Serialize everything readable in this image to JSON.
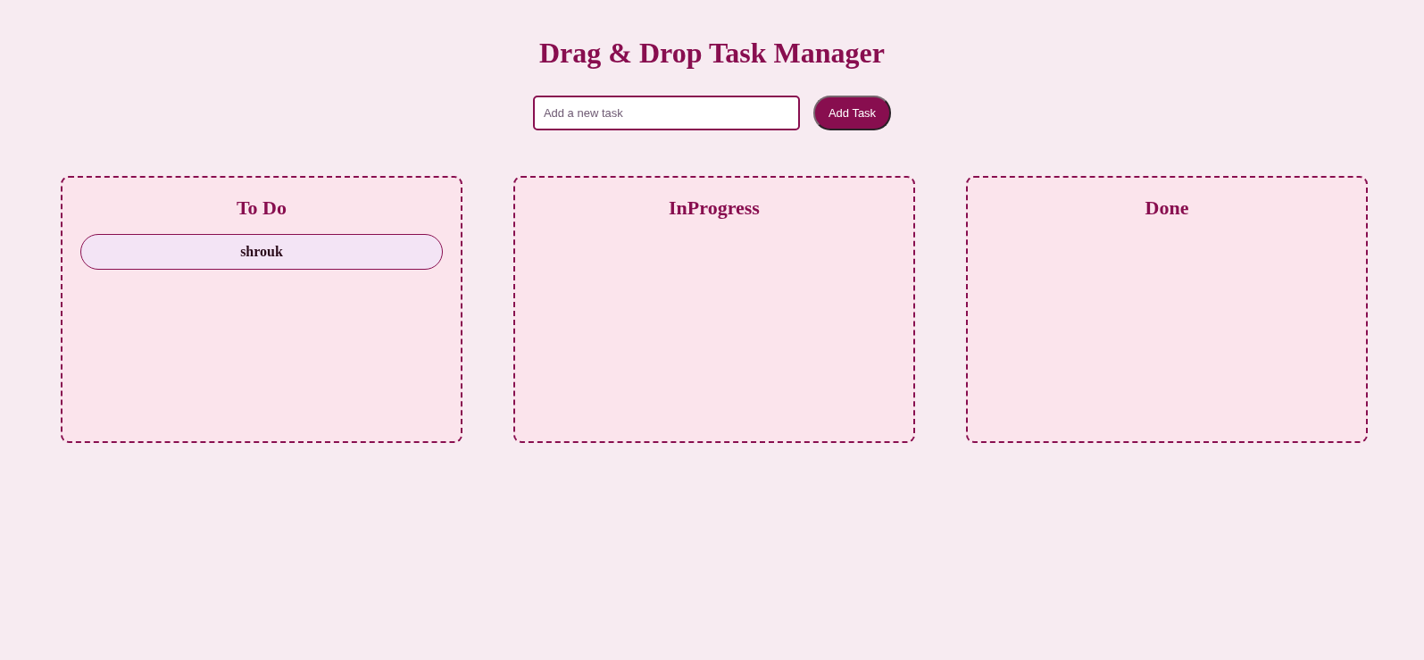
{
  "title": "Drag & Drop Task Manager",
  "new_task": {
    "placeholder": "Add a new task",
    "button": "Add Task"
  },
  "columns": [
    {
      "title": "To Do",
      "tasks": [
        {
          "label": "shrouk"
        }
      ]
    },
    {
      "title": "InProgress"
    },
    {
      "title": "Done"
    }
  ]
}
